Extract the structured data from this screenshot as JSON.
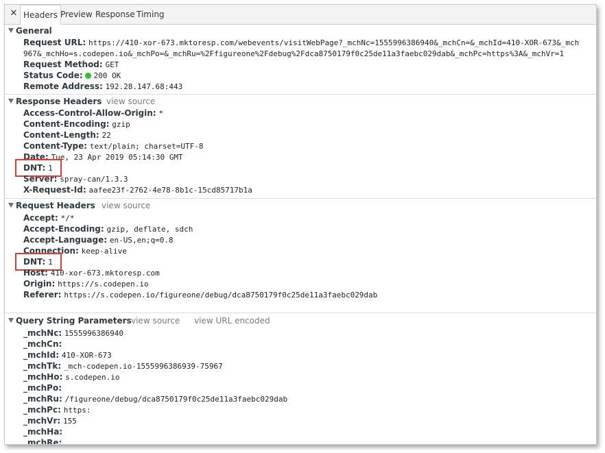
{
  "tabs": [
    "Headers",
    "Preview",
    "Response",
    "Timing"
  ],
  "general": {
    "title": "General",
    "rows": [
      {
        "k": "Request URL:",
        "v": "https://410-xor-673.mktoresp.com/webevents/visitWebPage?_mchNc=1555996386940&_mchCn=&_mchId=410-XOR-673&_mch"
      },
      {
        "k": "",
        "v": "967&_mchHo=s.codepen.io&_mchPo=&_mchRu=%2Ffigureone%2Fdebug%2Fdca8750179f0c25de11a3faebc029dab&_mchPc=https%3A&_mchVr=1"
      },
      {
        "k": "Request Method:",
        "v": "GET"
      },
      {
        "k": "Status Code:",
        "v": "200 OK"
      },
      {
        "k": "Remote Address:",
        "v": "192.28.147.68:443"
      }
    ]
  },
  "response_headers": {
    "title": "Response Headers",
    "view_source": "view source",
    "rows": [
      {
        "k": "Access-Control-Allow-Origin:",
        "v": "*"
      },
      {
        "k": "Content-Encoding:",
        "v": "gzip"
      },
      {
        "k": "Content-Length:",
        "v": "22"
      },
      {
        "k": "Content-Type:",
        "v": "text/plain; charset=UTF-8"
      },
      {
        "k": "Date:",
        "v": "Tue, 23 Apr 2019 05:14:30 GMT"
      },
      {
        "k": "DNT:",
        "v": "1"
      },
      {
        "k": "Server:",
        "v": "spray-can/1.3.3"
      },
      {
        "k": "X-Request-Id:",
        "v": "aafee23f-2762-4e78-8b1c-15cd85717b1a"
      }
    ]
  },
  "request_headers": {
    "title": "Request Headers",
    "view_source": "view source",
    "rows": [
      {
        "k": "Accept:",
        "v": "*/*"
      },
      {
        "k": "Accept-Encoding:",
        "v": "gzip, deflate, sdch"
      },
      {
        "k": "Accept-Language:",
        "v": "en-US,en;q=0.8"
      },
      {
        "k": "Connection:",
        "v": "keep-alive"
      },
      {
        "k": "DNT:",
        "v": "1"
      },
      {
        "k": "Host:",
        "v": "410-xor-673.mktoresp.com"
      },
      {
        "k": "Origin:",
        "v": "https://s.codepen.io"
      },
      {
        "k": "Referer:",
        "v": "https://s.codepen.io/figureone/debug/dca8750179f0c25de11a3faebc029dab"
      }
    ]
  },
  "query_params": {
    "title": "Query String Parameters",
    "view_source": "view source",
    "view_url_encoded": "view URL encoded",
    "rows": [
      {
        "k": "_mchNc:",
        "v": "1555996386940"
      },
      {
        "k": "_mchCn:",
        "v": ""
      },
      {
        "k": "_mchId:",
        "v": "410-XOR-673"
      },
      {
        "k": "_mchTk:",
        "v": "_mch-codepen.io-1555996386939-75967"
      },
      {
        "k": "_mchHo:",
        "v": "s.codepen.io"
      },
      {
        "k": "_mchPo:",
        "v": ""
      },
      {
        "k": "_mchRu:",
        "v": "/figureone/debug/dca8750179f0c25de11a3faebc029dab"
      },
      {
        "k": "_mchPc:",
        "v": "https:"
      },
      {
        "k": "_mchVr:",
        "v": "155"
      },
      {
        "k": "_mchHa:",
        "v": ""
      },
      {
        "k": "_mchRe:",
        "v": ""
      }
    ]
  },
  "colors": {
    "highlight": "#e53935",
    "status_ok": "#2fc12f"
  }
}
